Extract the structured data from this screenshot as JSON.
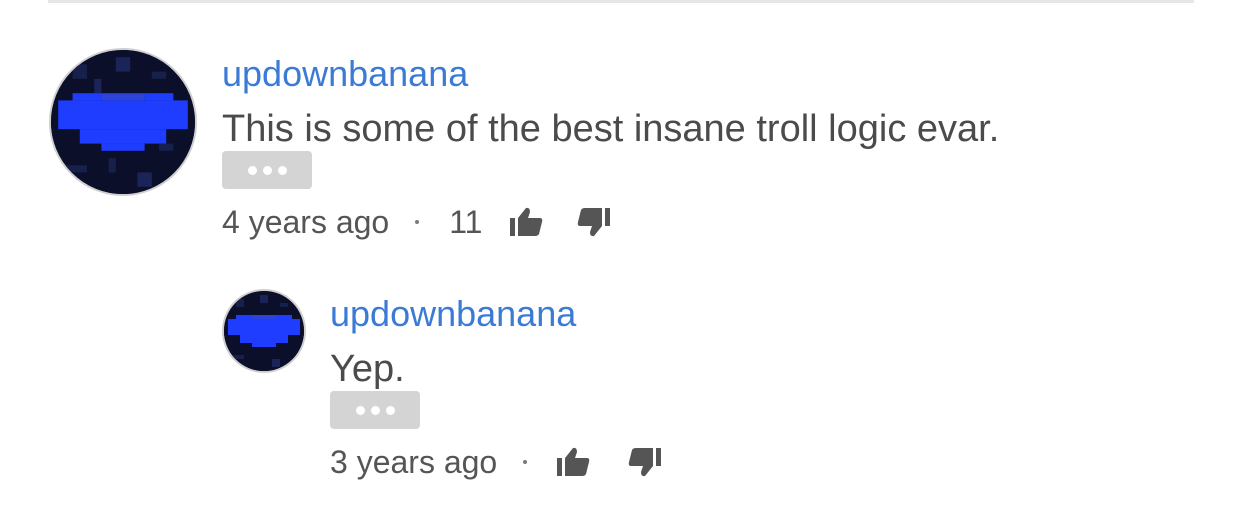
{
  "comments": [
    {
      "author": "updownbanana",
      "text": "This is some of the best insane troll logic evar.",
      "timestamp": "4 years ago",
      "likes": "11",
      "icons": {
        "like": "thumbs-up-icon",
        "dislike": "thumbs-down-icon",
        "more": "ellipsis-icon"
      }
    }
  ],
  "replies": [
    {
      "author": "updownbanana",
      "text": "Yep.",
      "timestamp": "3 years ago",
      "likes": "",
      "icons": {
        "like": "thumbs-up-icon",
        "dislike": "thumbs-down-icon",
        "more": "ellipsis-icon"
      }
    }
  ],
  "colors": {
    "author": "#3b7bd6",
    "text": "#4b4b4b",
    "meta": "#555555",
    "more_button": "#d4d4d4",
    "avatar_blue": "#1f3dff"
  }
}
